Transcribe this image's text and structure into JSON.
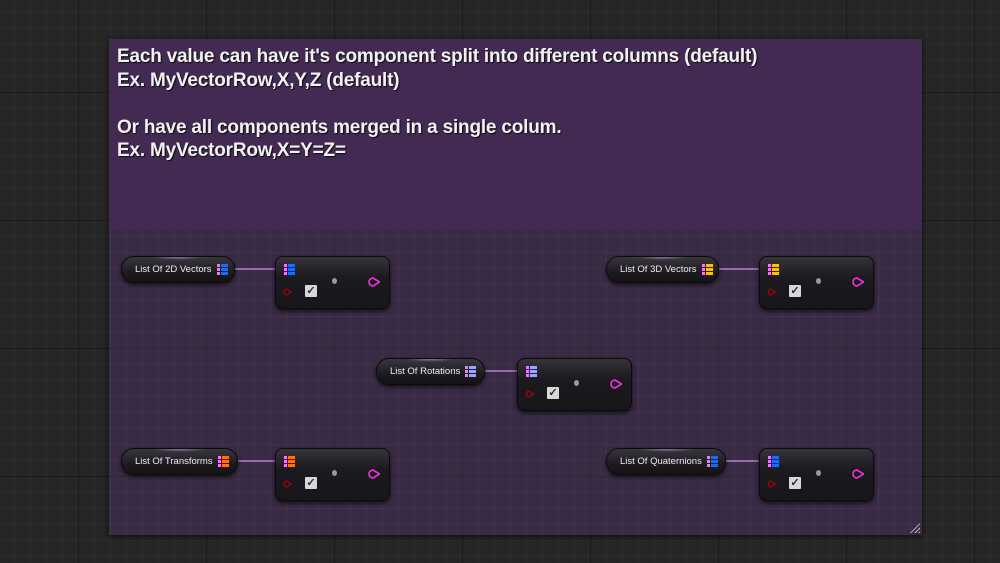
{
  "comment": {
    "text": "Each value can have it's component split into different columns (default)\nEx. MyVectorRow,X,Y,Z (default)\n\nOr have all components merged in a single colum.\nEx. MyVectorRow,X=Y=Z=",
    "header_color": "#432a52",
    "body_color": "#3a2b45"
  },
  "colors": {
    "wire": "#c98ef2",
    "array_pin_edge": "#e67df2",
    "exec_pin": "#8c0a14",
    "output_pin": "#e02fd9",
    "checkbox_checked": "#d8d8d8"
  },
  "nodes": [
    {
      "variable_label": "List Of 2D Vectors",
      "pin_type": "vector2d",
      "pin_color": "#1e6ce6",
      "checkbox_checked": true,
      "checkbox_glyph": "✓"
    },
    {
      "variable_label": "List Of 3D Vectors",
      "pin_type": "vector",
      "pin_color": "#f2c21e",
      "checkbox_checked": true,
      "checkbox_glyph": "✓"
    },
    {
      "variable_label": "List Of Rotations",
      "pin_type": "rotator",
      "pin_color": "#9ca6f2",
      "checkbox_checked": true,
      "checkbox_glyph": "✓"
    },
    {
      "variable_label": "List Of Transforms",
      "pin_type": "transform",
      "pin_color": "#f2761e",
      "checkbox_checked": true,
      "checkbox_glyph": "✓"
    },
    {
      "variable_label": "List Of Quaternions",
      "pin_type": "quat",
      "pin_color": "#1e6ce6",
      "checkbox_checked": true,
      "checkbox_glyph": "✓"
    }
  ]
}
